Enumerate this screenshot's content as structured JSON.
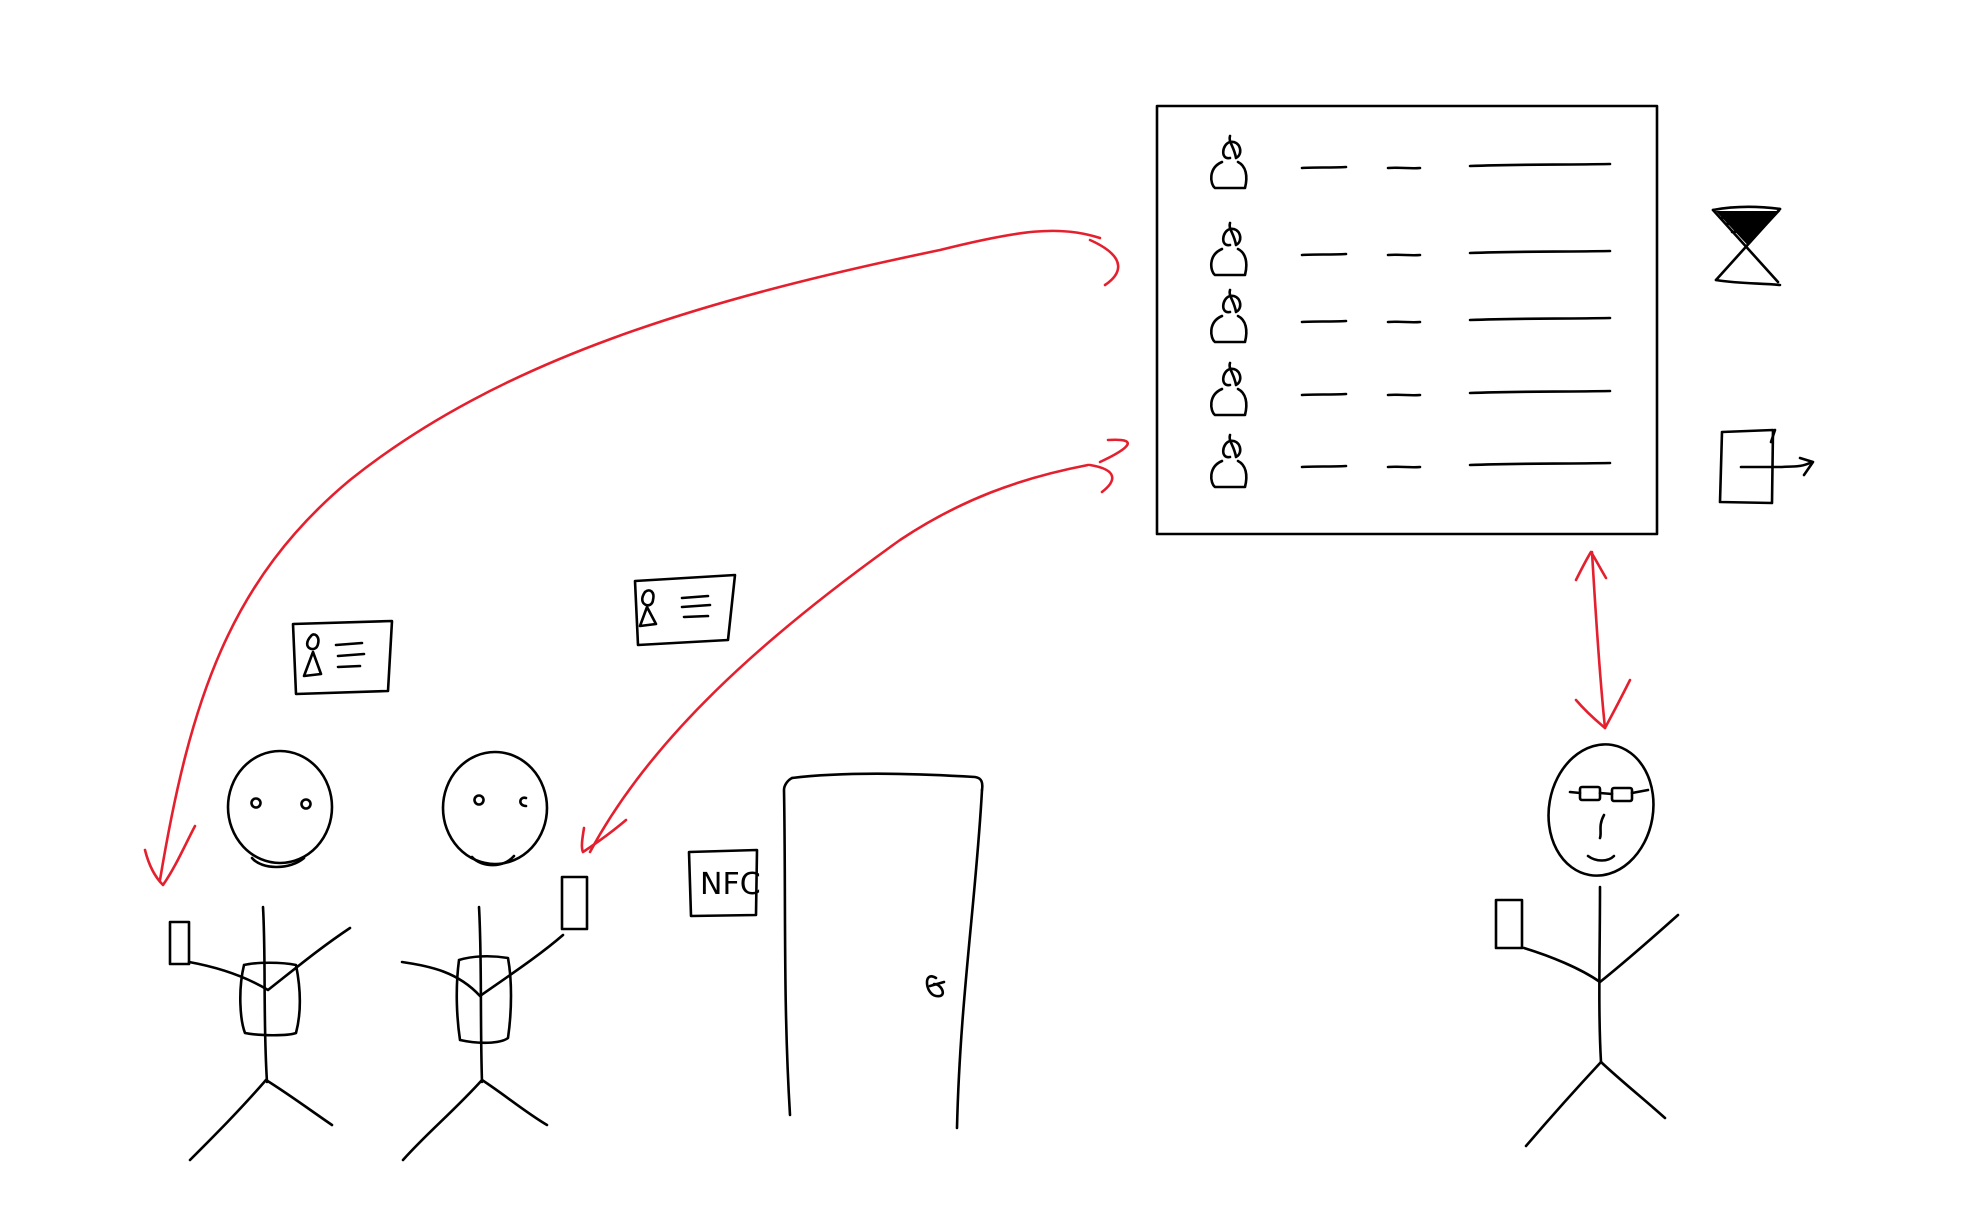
{
  "colors": {
    "ink": "#000000",
    "arrow": "#e5202e",
    "background": "#ffffff"
  },
  "nfc_reader": {
    "label": "NFC"
  },
  "attendance_board": {
    "rows": [
      {
        "icon": "person-icon"
      },
      {
        "icon": "person-icon"
      },
      {
        "icon": "person-icon"
      },
      {
        "icon": "person-icon"
      },
      {
        "icon": "person-icon"
      }
    ]
  },
  "side_icons": [
    "hourglass-icon",
    "export-icon"
  ],
  "people": [
    {
      "name": "student-1",
      "holds": "phone"
    },
    {
      "name": "student-2",
      "holds": "phone"
    },
    {
      "name": "teacher",
      "holds": "phone",
      "wears": "glasses"
    }
  ],
  "id_cards": [
    {
      "name": "id-card-1"
    },
    {
      "name": "id-card-2"
    }
  ]
}
